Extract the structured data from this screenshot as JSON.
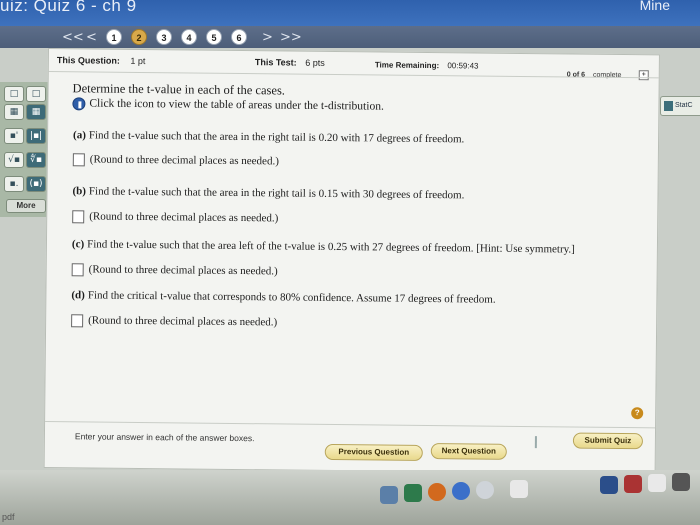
{
  "window": {
    "title": "uiz: Quiz 6 - ch 9",
    "right_text": "Mine"
  },
  "nav": {
    "prev_label": "<<",
    "prev_single": "<",
    "next_single": ">",
    "next_label": ">>",
    "questions": [
      "1",
      "2",
      "3",
      "4",
      "5",
      "6"
    ],
    "current": "2"
  },
  "info": {
    "this_question_label": "This Question:",
    "this_question_value": "1 pt",
    "this_test_label": "This Test:",
    "this_test_value": "6 pts",
    "time_label": "Time Remaining:",
    "time_value": "00:59:43",
    "progress_count": "0 of 6",
    "progress_word": "complete"
  },
  "question": {
    "prompt": "Determine the t-value in each of the cases.",
    "table_link": "Click the icon to view the table of areas under the t-distribution.",
    "parts": [
      {
        "label": "(a)",
        "text": "Find the t-value such that the area in the right tail is 0.20 with 17 degrees of freedom.",
        "answer": "(Round to three decimal places as needed.)"
      },
      {
        "label": "(b)",
        "text": "Find the t-value such that the area in the right tail is 0.15 with 30 degrees of freedom.",
        "answer": "(Round to three decimal places as needed.)"
      },
      {
        "label": "(c)",
        "text": "Find the t-value such that the area left of the t-value is 0.25 with 27 degrees of freedom. [Hint: Use symmetry.]",
        "answer": "(Round to three decimal places as needed.)"
      },
      {
        "label": "(d)",
        "text": "Find the critical t-value that corresponds to 80% confidence. Assume 17 degrees of freedom.",
        "answer": "(Round to three decimal places as needed.)"
      }
    ]
  },
  "toolbar": {
    "more_label": "More",
    "tools": [
      "□",
      "□",
      "▦",
      "▦",
      "▪'",
      "|▪|",
      "√▪",
      "∜▪",
      "▪.",
      "(▪)"
    ]
  },
  "side": {
    "stat_label": "StatC"
  },
  "footer": {
    "instruction": "Enter your answer in each of the answer boxes.",
    "prev_button": "Previous Question",
    "next_button": "Next Question",
    "submit_button": "Submit Quiz",
    "help_icon": "?"
  },
  "taskbar": {
    "pdf_label": "pdf"
  }
}
